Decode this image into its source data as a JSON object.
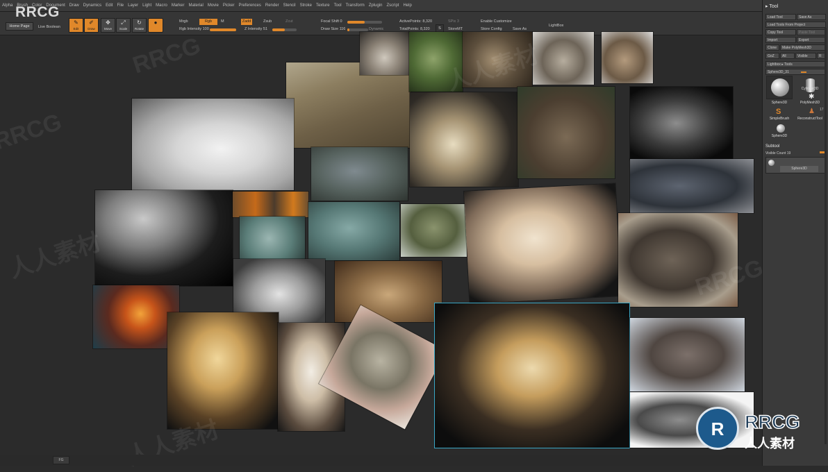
{
  "menu": {
    "items": [
      "Alpha",
      "Brush",
      "Color",
      "Document",
      "Draw",
      "Dynamics",
      "Edit",
      "File",
      "Layer",
      "Light",
      "Macro",
      "Marker",
      "Material",
      "Movie",
      "Picker",
      "Preferences",
      "Render",
      "Stencil",
      "Stroke",
      "Texture",
      "Tool",
      "Transform",
      "Zplugin",
      "Zscript",
      "Help"
    ]
  },
  "toolbar": {
    "home_page": "Home Page",
    "live_boolean": "Live Boolean",
    "tools": [
      {
        "label": "Edit",
        "icon": "edit-icon",
        "active": true
      },
      {
        "label": "Draw",
        "icon": "draw-icon",
        "active": true
      },
      {
        "label": "Move",
        "icon": "move-icon",
        "active": false
      },
      {
        "label": "Scale",
        "icon": "scale-icon",
        "active": false
      },
      {
        "label": "Rotate",
        "icon": "rotate-icon",
        "active": false
      }
    ],
    "mrgb": "Mrgb",
    "rgb": "Rgb",
    "m": "M",
    "rgb_intensity": "Rgb Intensity 100",
    "zadd": "Zadd",
    "zsub": "Zsub",
    "zcut": "Zcut",
    "z_intensity": "Z Intensity 51",
    "focal_shift": "Focal Shift 0",
    "draw_size": "Draw Size 116",
    "dynamic": "Dynamic",
    "active_points": "ActivePoints: 8,320",
    "total_points": "TotalPoints: 8,320",
    "s_label": "S",
    "spix": "SPix 3",
    "store_mt": "StoreMT",
    "del_mt": "DelMT",
    "enable_customize": "Enable Customize",
    "store_config": "Store Config",
    "save_as": "Save As",
    "lightbox": "LightBox",
    "rgb_intensity_value": 1.0,
    "z_intensity_value": 0.51,
    "focal_shift_value": 0.0,
    "draw_size_value": 0.116
  },
  "palette": {
    "title": "Tool",
    "buttons": {
      "load_tool": "Load Tool",
      "save_as": "Save As",
      "load_tools_from_project": "Load Tools From Project",
      "copy_tool": "Copy Tool",
      "paste_tool": "Paste Tool",
      "import": "Import",
      "export": "Export",
      "clone": "Clone",
      "make_polymesh": "Make PolyMesh3D",
      "goz": "GoZ",
      "all": "All",
      "visible": "Visible",
      "r": "R",
      "lightbox_tools": "Lightbox ▸ Tools"
    },
    "current_tool": "Sphere3D_31",
    "tools": [
      {
        "label": "Sphere3D"
      },
      {
        "label": "Cylinder3D"
      },
      {
        "label": "PolyMesh3D"
      },
      {
        "label": "SimpleBrush"
      },
      {
        "label": "ReconstructTool"
      },
      {
        "label": "Sphere3D"
      }
    ],
    "poly_count": "17",
    "subtool_title": "Subtool",
    "visible_count": "Visible Count 19",
    "subtool_item": "Sphere3D"
  },
  "bottom": {
    "chip": "FG"
  },
  "watermark": {
    "logo": "RRCG",
    "brand_mark": "R",
    "brand_name": "RRCG",
    "brand_cn": "人人素材"
  },
  "colors": {
    "accent": "#e0882a",
    "selection": "#39a7c6",
    "canvas": "#2b2b2b"
  },
  "references": [
    "albino-alligator",
    "crocodile-scales",
    "turtle-skull-1",
    "green-turtle-head",
    "snapping-turtle-head",
    "turtle-skull-2",
    "turtle-skull-3",
    "dragon-head-sculpts",
    "rhino-iguana",
    "skeleton-fang",
    "dunkleosteus-model",
    "reptile-eye-orange",
    "iguana-face",
    "iguana-side",
    "water-dragon",
    "fish-skeleton-model",
    "bat-skull",
    "dunkleosteus-skull",
    "dragon-eye",
    "alligator-sketch",
    "toad-lips",
    "bat-skull-yellow",
    "bat-skull-front",
    "snake-head",
    "bat-skeleton-closeup",
    "dunkleosteus-bronze",
    "dunkleosteus-render"
  ]
}
